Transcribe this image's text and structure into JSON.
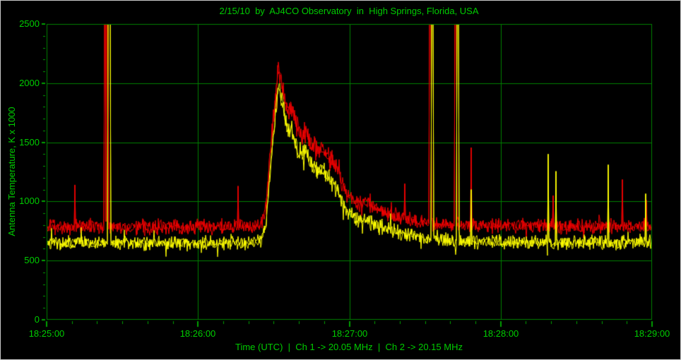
{
  "chart_data": {
    "type": "line",
    "title": "2/15/10  by  AJ4CO Observatory  in  High Springs, Florida, USA",
    "ylabel": "Antenna Temperature, K x 1000",
    "xlabel": "Time (UTC)  |  Ch 1 -> 20.05 MHz  |  Ch 2 -> 20.15 MHz",
    "x_ticks": [
      "18:25:00",
      "18:26:00",
      "18:27:00",
      "18:28:00",
      "18:29:00"
    ],
    "x_range_seconds": [
      0,
      240
    ],
    "x_major_step_seconds": 60,
    "x_minor_step_seconds": 10,
    "ylim": [
      0,
      2500
    ],
    "y_tick_labels": [
      "0",
      "500",
      "1000",
      "1500",
      "2000",
      "2500"
    ],
    "y_major_step": 500,
    "y_minor_step": 100,
    "grid": true,
    "legend": "none (channel info shown in x-axis label)",
    "colors": {
      "background": "#000000",
      "frame": "#008000",
      "grid": "#008000",
      "tick": "#00a000",
      "text": "#00cc00",
      "ch1": "#ee0000",
      "ch2": "#ffff00",
      "window_border": "#c8c8c8"
    },
    "noise_seed": 1337,
    "description": "Two-channel radio strip chart; noisy baselines with a large burst peaking ~2130 K x1000 near 18:26:32 and several full-scale interference spikes.",
    "series": [
      {
        "name": "Ch 1 (20.05 MHz)",
        "color_key": "ch1",
        "baseline": 785,
        "noise_amp": 55,
        "envelope": [
          [
            0,
            785
          ],
          [
            82,
            785
          ],
          [
            85,
            800
          ],
          [
            87,
            950
          ],
          [
            89,
            1500
          ],
          [
            91,
            1950
          ],
          [
            92,
            2130
          ],
          [
            93,
            2030
          ],
          [
            94,
            1890
          ],
          [
            95.5,
            1750
          ],
          [
            97,
            1800
          ],
          [
            99,
            1640
          ],
          [
            101,
            1560
          ],
          [
            103,
            1600
          ],
          [
            105,
            1470
          ],
          [
            107,
            1420
          ],
          [
            109,
            1460
          ],
          [
            111,
            1400
          ],
          [
            113,
            1350
          ],
          [
            115,
            1280
          ],
          [
            117,
            1170
          ],
          [
            119,
            1070
          ],
          [
            121,
            1020
          ],
          [
            124,
            980
          ],
          [
            127,
            1000
          ],
          [
            130,
            950
          ],
          [
            134,
            915
          ],
          [
            139,
            875
          ],
          [
            145,
            845
          ],
          [
            152,
            820
          ],
          [
            160,
            800
          ],
          [
            170,
            792
          ],
          [
            240,
            790
          ]
        ],
        "spikes": [
          {
            "t": 23.2,
            "v": 2600,
            "w": 0.6
          },
          {
            "t": 24.1,
            "v": 2600,
            "w": 0.6
          },
          {
            "t": 11.2,
            "v": 1140,
            "w": 0.3
          },
          {
            "t": 76.0,
            "v": 1130,
            "w": 0.3
          },
          {
            "t": 142.0,
            "v": 1150,
            "w": 0.3
          },
          {
            "t": 152.1,
            "v": 2600,
            "w": 0.8
          },
          {
            "t": 162.1,
            "v": 2600,
            "w": 0.8
          },
          {
            "t": 168.2,
            "v": 1455,
            "w": 0.3
          },
          {
            "t": 200.8,
            "v": 1050,
            "w": 0.3
          },
          {
            "t": 228.2,
            "v": 1185,
            "w": 0.3
          },
          {
            "t": 237.7,
            "v": 1010,
            "w": 0.3
          }
        ]
      },
      {
        "name": "Ch 2 (20.15 MHz)",
        "color_key": "ch2",
        "baseline": 648,
        "noise_amp": 50,
        "envelope": [
          [
            0,
            648
          ],
          [
            82,
            648
          ],
          [
            85,
            665
          ],
          [
            87,
            820
          ],
          [
            89,
            1350
          ],
          [
            91,
            1820
          ],
          [
            92,
            2020
          ],
          [
            93,
            1900
          ],
          [
            94,
            1760
          ],
          [
            95.5,
            1600
          ],
          [
            97,
            1620
          ],
          [
            99,
            1470
          ],
          [
            101,
            1400
          ],
          [
            103,
            1420
          ],
          [
            105,
            1300
          ],
          [
            107,
            1260
          ],
          [
            109,
            1280
          ],
          [
            111,
            1220
          ],
          [
            113,
            1170
          ],
          [
            115,
            1100
          ],
          [
            117,
            1000
          ],
          [
            119,
            920
          ],
          [
            121,
            880
          ],
          [
            124,
            840
          ],
          [
            127,
            850
          ],
          [
            130,
            805
          ],
          [
            134,
            775
          ],
          [
            139,
            740
          ],
          [
            145,
            705
          ],
          [
            152,
            685
          ],
          [
            160,
            668
          ],
          [
            170,
            658
          ],
          [
            240,
            652
          ]
        ],
        "spikes": [
          {
            "t": 24.8,
            "v": 2600,
            "w": 0.9
          },
          {
            "t": 152.9,
            "v": 2600,
            "w": 0.8
          },
          {
            "t": 163.1,
            "v": 2600,
            "w": 0.8
          },
          {
            "t": 168.4,
            "v": 1100,
            "w": 0.3
          },
          {
            "t": 198.8,
            "v": 1400,
            "w": 0.3
          },
          {
            "t": 201.9,
            "v": 1255,
            "w": 0.3
          },
          {
            "t": 222.6,
            "v": 1310,
            "w": 0.3
          },
          {
            "t": 237.5,
            "v": 1065,
            "w": 0.3
          }
        ]
      }
    ]
  }
}
